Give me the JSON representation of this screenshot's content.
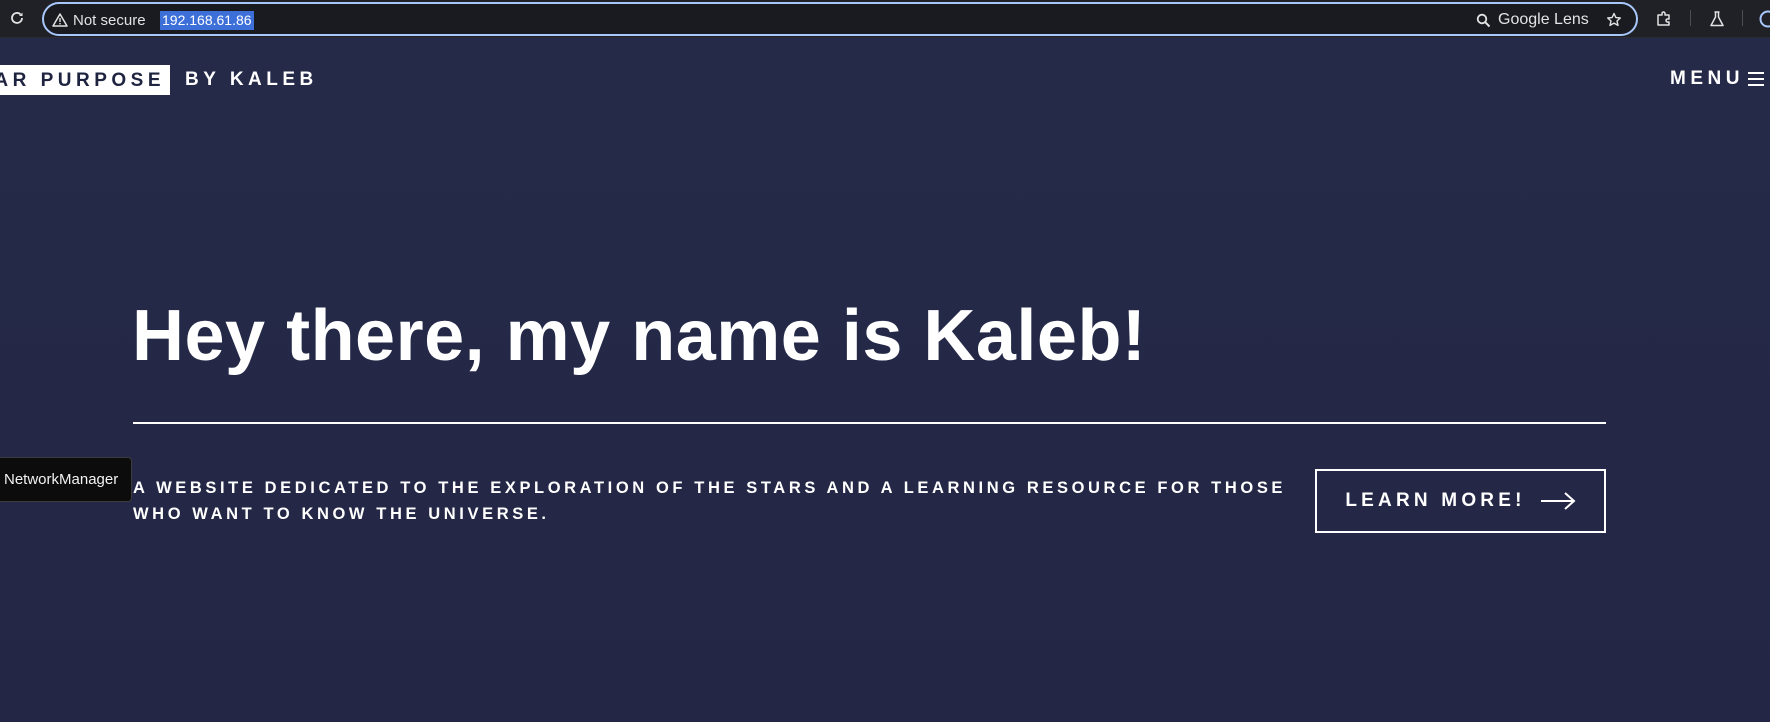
{
  "browser": {
    "security_label": "Not secure",
    "url": "192.168.61.86",
    "lens_label": "Google Lens",
    "accent_color": "#a8c7fa"
  },
  "site": {
    "logo_boxed": "AR PURPOSE",
    "logo_by": "BY KALEB",
    "menu_label": "MENU"
  },
  "hero": {
    "title": "Hey there, my name is Kaleb!",
    "tagline": "A WEBSITE DEDICATED TO THE EXPLORATION OF THE STARS AND A LEARNING RESOURCE FOR THOSE WHO WANT TO KNOW THE UNIVERSE.",
    "cta_label": "LEARN MORE!"
  },
  "tooltip": {
    "text": "NetworkManager"
  },
  "colors": {
    "page_background": "#252a48",
    "text": "#ffffff"
  },
  "icons": [
    "reload-icon",
    "warning-icon",
    "search-icon",
    "star-icon",
    "extensions-icon",
    "labs-flask-icon",
    "hamburger-icon",
    "arrow-right-icon"
  ]
}
